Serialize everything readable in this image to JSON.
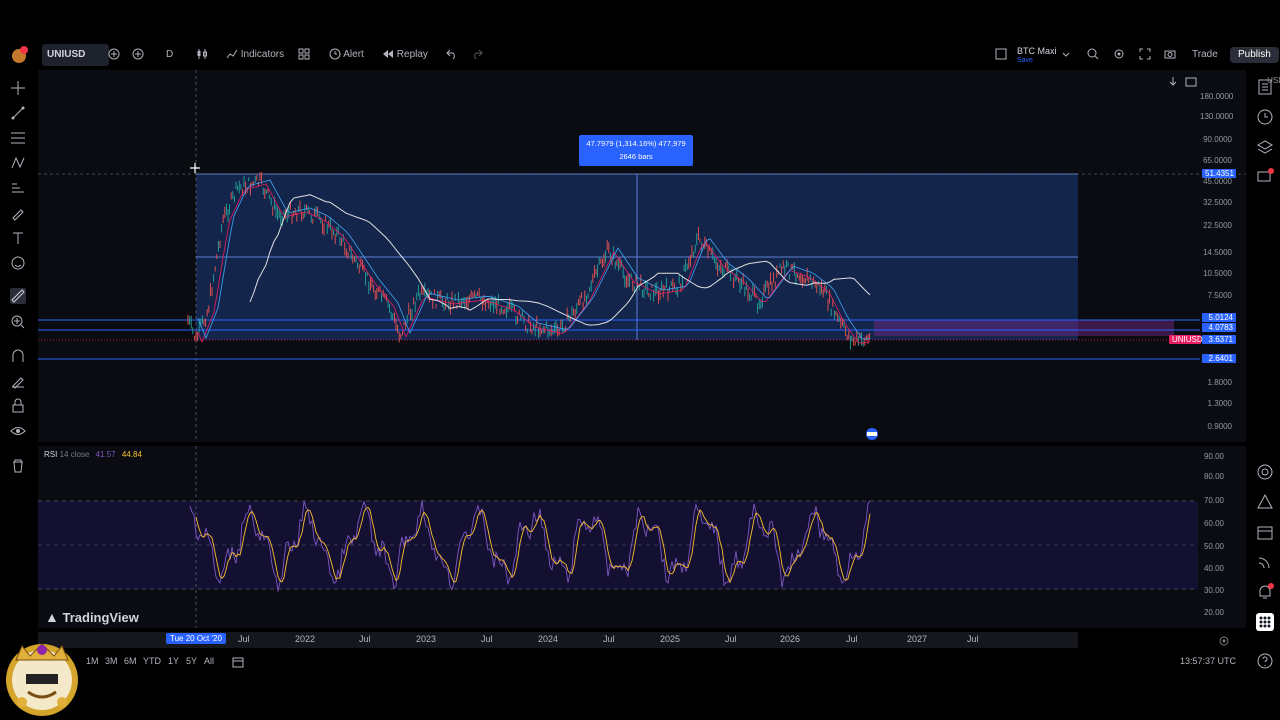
{
  "topbar": {
    "symbol": "UNIUSD",
    "interval": "D",
    "indicators": "Indicators",
    "alert": "Alert",
    "replay": "Replay",
    "layout_name": "BTC Maxi",
    "layout_status": "Save",
    "trade": "Trade",
    "publish": "Publish"
  },
  "price_axis": {
    "currency": "USD",
    "ticks": [
      "180.0000",
      "130.0000",
      "90.0000",
      "65.0000",
      "45.0000",
      "32.5000",
      "22.5000",
      "14.5000",
      "10.5000",
      "7.5000",
      "1.8000",
      "1.3000",
      "0.9000"
    ],
    "labels": [
      {
        "text": "51.4351",
        "color": "#2962ff"
      },
      {
        "text": "5.0124",
        "color": "#2962ff"
      },
      {
        "text": "4.0783",
        "color": "#2962ff"
      },
      {
        "text": "3.6371",
        "color": "#2962ff"
      },
      {
        "text": "2.6401",
        "color": "#2962ff"
      }
    ],
    "symbol_tag": "UNIUSD"
  },
  "measure": {
    "line1": "47.7979 (1,314.16%) 477,979",
    "line2": "2646 bars"
  },
  "rsi": {
    "name": "RSI",
    "params": "14 close",
    "value1": "41.57",
    "value2": "44.84",
    "ticks": [
      "90.00",
      "80.00",
      "70.00",
      "60.00",
      "50.00",
      "40.00",
      "30.00",
      "20.00"
    ]
  },
  "time_axis": {
    "cursor_label": "Tue 20 Oct '20",
    "labels": [
      "Jul",
      "2022",
      "Jul",
      "2023",
      "Jul",
      "2024",
      "Jul",
      "2025",
      "Jul",
      "2026",
      "Jul",
      "2027",
      "Jul"
    ]
  },
  "bottom": {
    "ranges": [
      "1M",
      "3M",
      "6M",
      "YTD",
      "1Y",
      "5Y",
      "All"
    ],
    "clock": "13:57:37 UTC"
  },
  "branding": {
    "logo_text": "TradingView"
  },
  "colors": {
    "accent": "#2962ff",
    "rsi": "#7e57c2",
    "price_line": "#e91e63"
  }
}
